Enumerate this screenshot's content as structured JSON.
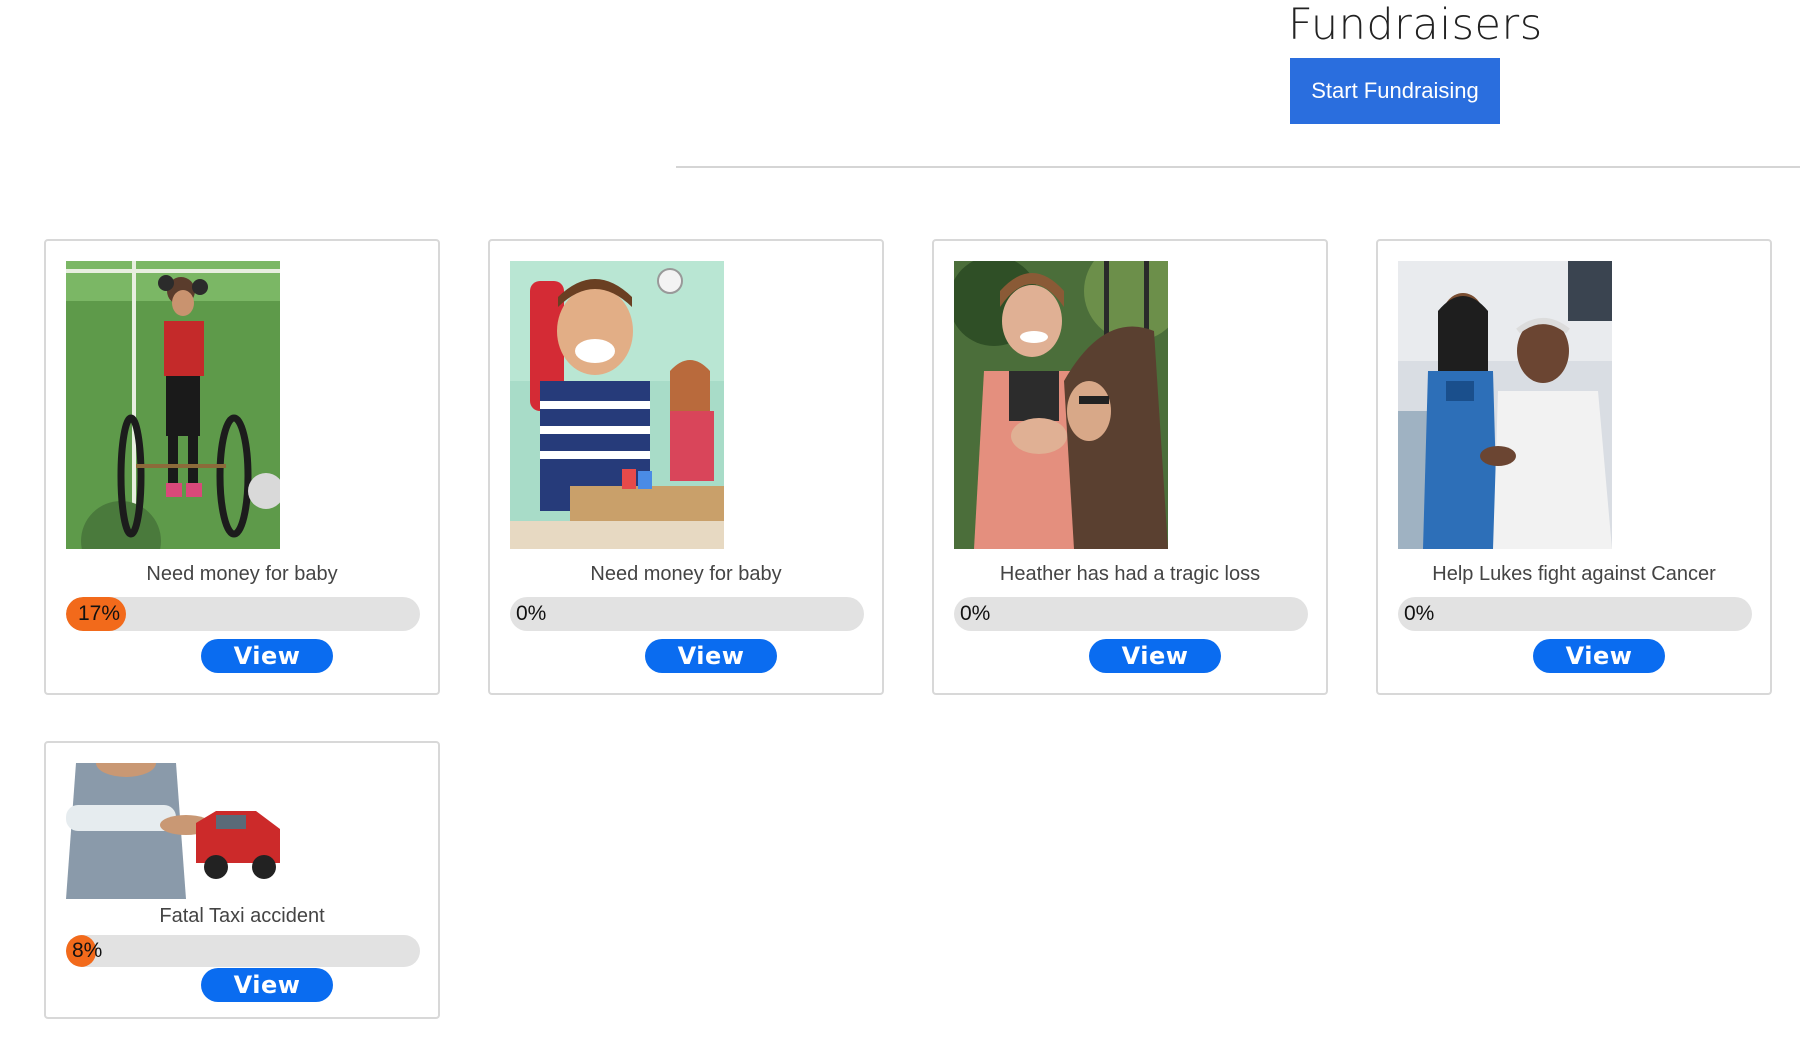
{
  "header": {
    "title": "Fundraisers",
    "start_button": "Start Fundraising"
  },
  "colors": {
    "primary_button": "#2a6ede",
    "view_button": "#0a6cf0",
    "progress_fill": "#f26a1b",
    "progress_track": "#e2e2e2"
  },
  "fundraisers": [
    {
      "title": "Need money for baby",
      "progress_label": "17%",
      "progress": 0.17,
      "view_label": "View",
      "image": "child-in-wheelchair-photo"
    },
    {
      "title": "Need money for baby",
      "progress_label": "0%",
      "progress": 0,
      "view_label": "View",
      "image": "smiling-boy-photo"
    },
    {
      "title": "Heather has had a tragic loss",
      "progress_label": "0%",
      "progress": 0,
      "view_label": "View",
      "image": "two-women-talking-photo"
    },
    {
      "title": "Help Lukes fight against Cancer",
      "progress_label": "0%",
      "progress": 0,
      "view_label": "View",
      "image": "doctor-patient-photo"
    },
    {
      "title": "Fatal Taxi accident",
      "progress_label": "8%",
      "progress": 0.08,
      "view_label": "View",
      "image": "arm-cast-car-crash-photo"
    }
  ]
}
